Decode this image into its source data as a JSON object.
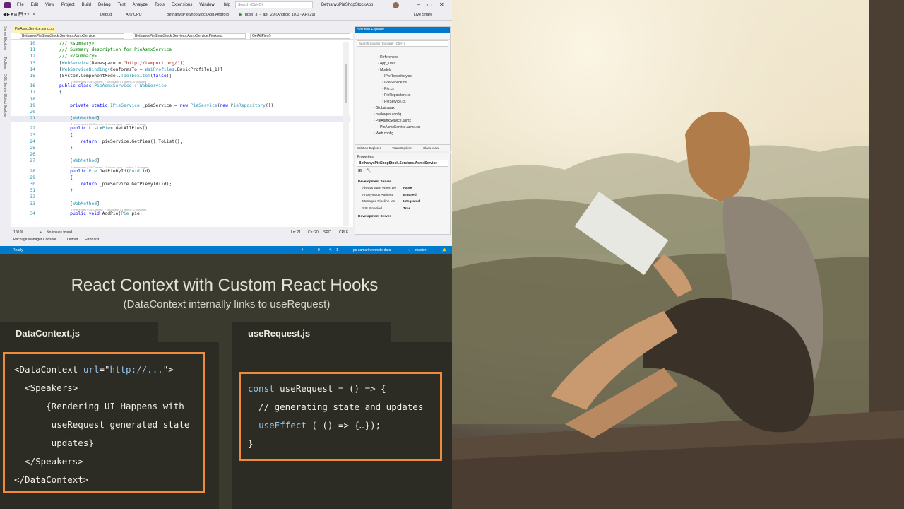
{
  "vs": {
    "menu": [
      "File",
      "Edit",
      "View",
      "Project",
      "Build",
      "Debug",
      "Test",
      "Analyze",
      "Tools",
      "Extensions",
      "Window",
      "Help"
    ],
    "search_placeholder": "Search (Ctrl+Q)",
    "app_title": "BethanysPieShopStockApp",
    "toolbar": {
      "config": "Debug",
      "platform": "Any CPU",
      "project": "BethanysPieShopStockApp.Android",
      "run_target": "pixel_3_-_api_29 (Android 10.0 - API 29)",
      "live_share": "Live Share"
    },
    "left_strip": [
      "Server Explorer",
      "Toolbox",
      "SQL Server Object Explorer"
    ],
    "doc_tab": "PieAsmxService.asmx.cs",
    "nav": {
      "project": "BethanysPieShopStock.Services.AsmxService",
      "class": "BethanysPieShopStock.Services.AsmxService.PieAsmx",
      "member": "GetAllPies()"
    },
    "code_lines": [
      {
        "n": "10",
        "parts": [
          {
            "t": "/// <summary>",
            "c": "cm"
          }
        ]
      },
      {
        "n": "11",
        "parts": [
          {
            "t": "/// Summary description for PieAsmxService",
            "c": "cm"
          }
        ]
      },
      {
        "n": "12",
        "parts": [
          {
            "t": "/// </summary>",
            "c": "cm"
          }
        ]
      },
      {
        "n": "13",
        "parts": [
          {
            "t": "[",
            "c": ""
          },
          {
            "t": "WebService",
            "c": "ty"
          },
          {
            "t": "(Namespace = ",
            "c": ""
          },
          {
            "t": "\"http://tempuri.org/\"",
            "c": "st"
          },
          {
            "t": ")]",
            "c": ""
          }
        ]
      },
      {
        "n": "14",
        "parts": [
          {
            "t": "[",
            "c": ""
          },
          {
            "t": "WebServiceBinding",
            "c": "ty"
          },
          {
            "t": "(ConformsTo = ",
            "c": ""
          },
          {
            "t": "WsiProfiles",
            "c": "ty"
          },
          {
            "t": ".BasicProfile1_1)]",
            "c": ""
          }
        ]
      },
      {
        "n": "15",
        "parts": [
          {
            "t": "[System.ComponentModel.",
            "c": ""
          },
          {
            "t": "ToolboxItem",
            "c": "ty"
          },
          {
            "t": "(",
            "c": ""
          },
          {
            "t": "false",
            "c": "kw"
          },
          {
            "t": ")]",
            "c": ""
          }
        ]
      },
      {
        "n": "16",
        "parts": [
          {
            "t": "public class ",
            "c": "kw"
          },
          {
            "t": "PieAsmxService",
            "c": "ty"
          },
          {
            "t": " : ",
            "c": ""
          },
          {
            "t": "WebService",
            "c": "ty"
          }
        ]
      },
      {
        "n": "17",
        "parts": [
          {
            "t": "{",
            "c": ""
          }
        ]
      },
      {
        "n": "18",
        "parts": [
          {
            "t": "",
            "c": ""
          }
        ]
      },
      {
        "n": "19",
        "parts": [
          {
            "t": "    private static ",
            "c": "kw"
          },
          {
            "t": "IPieService",
            "c": "ty"
          },
          {
            "t": " _pieService = ",
            "c": ""
          },
          {
            "t": "new ",
            "c": "kw"
          },
          {
            "t": "PieService",
            "c": "ty"
          },
          {
            "t": "(",
            "c": ""
          },
          {
            "t": "new ",
            "c": "kw"
          },
          {
            "t": "PieRepository",
            "c": "ty"
          },
          {
            "t": "());",
            "c": ""
          }
        ]
      },
      {
        "n": "20",
        "parts": [
          {
            "t": "",
            "c": ""
          }
        ]
      },
      {
        "n": "21",
        "parts": [
          {
            "t": "    [",
            "c": ""
          },
          {
            "t": "WebMethod",
            "c": "ty"
          },
          {
            "t": "]",
            "c": ""
          }
        ]
      },
      {
        "n": "22",
        "parts": [
          {
            "t": "    public ",
            "c": "kw"
          },
          {
            "t": "List",
            "c": "ty"
          },
          {
            "t": "<",
            "c": ""
          },
          {
            "t": "Pie",
            "c": "ty"
          },
          {
            "t": "> GetAllPies()",
            "c": ""
          }
        ]
      },
      {
        "n": "23",
        "parts": [
          {
            "t": "    {",
            "c": ""
          }
        ]
      },
      {
        "n": "24",
        "parts": [
          {
            "t": "        return ",
            "c": "kw"
          },
          {
            "t": "_pieService.GetPies().ToList();",
            "c": ""
          }
        ]
      },
      {
        "n": "25",
        "parts": [
          {
            "t": "    }",
            "c": ""
          }
        ]
      },
      {
        "n": "26",
        "parts": [
          {
            "t": "",
            "c": ""
          }
        ]
      },
      {
        "n": "27",
        "parts": [
          {
            "t": "    [",
            "c": ""
          },
          {
            "t": "WebMethod",
            "c": "ty"
          },
          {
            "t": "]",
            "c": ""
          }
        ]
      },
      {
        "n": "28",
        "parts": [
          {
            "t": "    public ",
            "c": "kw"
          },
          {
            "t": "Pie",
            "c": "ty"
          },
          {
            "t": " GetPieById(",
            "c": ""
          },
          {
            "t": "Guid",
            "c": "ty"
          },
          {
            "t": " id)",
            "c": ""
          }
        ]
      },
      {
        "n": "29",
        "parts": [
          {
            "t": "    {",
            "c": ""
          }
        ]
      },
      {
        "n": "30",
        "parts": [
          {
            "t": "        return ",
            "c": "kw"
          },
          {
            "t": "_pieService.GetPieById(id);",
            "c": ""
          }
        ]
      },
      {
        "n": "31",
        "parts": [
          {
            "t": "    }",
            "c": ""
          }
        ]
      },
      {
        "n": "32",
        "parts": [
          {
            "t": "",
            "c": ""
          }
        ]
      },
      {
        "n": "33",
        "parts": [
          {
            "t": "    [",
            "c": ""
          },
          {
            "t": "WebMethod",
            "c": "ty"
          },
          {
            "t": "]",
            "c": ""
          }
        ]
      },
      {
        "n": "34",
        "parts": [
          {
            "t": "    public void ",
            "c": "kw"
          },
          {
            "t": "AddPie(",
            "c": ""
          },
          {
            "t": "Pie",
            "c": "ty"
          },
          {
            "t": " pie)",
            "c": ""
          }
        ]
      }
    ],
    "code_lens": [
      "0 references | Gil Cleeren, 7 hours ago | 1 author, 3 changes",
      "0 references | Gil Cleeren, 15 hours ago | 1 author, 1 change",
      "0 references | Gil Cleeren, 15 hours ago | 1 author, 3 changes",
      "0 references | Gil Cleeren, 7 hours ago | 1 author, 2 changes"
    ],
    "status": {
      "zoom": "100 %",
      "issues": "No issues found",
      "ln": "Ln: 21",
      "ch": "Ch: 20",
      "spc": "SPC",
      "crlf": "CRLF"
    },
    "panel_tabs": [
      "Package Manager Console",
      "Output",
      "Error List"
    ],
    "statusbar": {
      "ready": "Ready",
      "up": "0",
      "pencil": "1",
      "repo": "ps-xamarin-remote-data",
      "branch": "master"
    },
    "solution_explorer": {
      "title": "Solution Explorer",
      "search": "Search Solution Explorer (Ctrl+;)",
      "items": [
        "References",
        "App_Data",
        "Models",
        "IPieRepository.cs",
        "IPieService.cs",
        "Pie.cs",
        "PieRepository.cs",
        "PieService.cs",
        "Global.asax",
        "packages.config",
        "PieAsmxService.asmx",
        "PieAsmxService.asmx.cs",
        "Web.config"
      ],
      "tabs": [
        "Solution Explorer",
        "Team Explorer",
        "Class View"
      ]
    },
    "properties": {
      "title": "Properties",
      "selected": "BethanysPieShopStock.Services.AsmxService",
      "section": "Development Server",
      "rows": [
        {
          "k": "Always Start When De",
          "v": "False"
        },
        {
          "k": "Anonymous Authent",
          "v": "Enabled"
        },
        {
          "k": "Managed Pipeline Mc",
          "v": "Integrated"
        },
        {
          "k": "SSL Enabled",
          "v": "True"
        }
      ],
      "footer": "Development Server"
    }
  },
  "slide": {
    "title": "React Context with Custom React Hooks",
    "subtitle": "(DataContext internally links to useRequest)",
    "left": {
      "tab": "DataContext.js",
      "lines": [
        [
          {
            "t": "<DataContext ",
            "c": ""
          },
          {
            "t": "url",
            "c": "blue"
          },
          {
            "t": "=\"",
            "c": ""
          },
          {
            "t": "http://...",
            "c": "blue"
          },
          {
            "t": "\">",
            "c": ""
          }
        ],
        [
          {
            "t": "  <Speakers>",
            "c": ""
          }
        ],
        [
          {
            "t": "      {Rendering UI Happens with",
            "c": ""
          }
        ],
        [
          {
            "t": "       useRequest generated state",
            "c": ""
          }
        ],
        [
          {
            "t": "       updates}",
            "c": ""
          }
        ],
        [
          {
            "t": "  </Speakers>",
            "c": ""
          }
        ],
        [
          {
            "t": "</DataContext>",
            "c": ""
          }
        ]
      ]
    },
    "right": {
      "tab": "useRequest.js",
      "lines": [
        [
          {
            "t": "const ",
            "c": "blue"
          },
          {
            "t": "useRequest = () => {",
            "c": ""
          }
        ],
        [
          {
            "t": "  // generating state and updates",
            "c": ""
          }
        ],
        [
          {
            "t": "  ",
            "c": ""
          },
          {
            "t": "useEffect",
            "c": "blue"
          },
          {
            "t": " ( () => {…});",
            "c": ""
          }
        ],
        [
          {
            "t": "}",
            "c": ""
          }
        ]
      ]
    }
  },
  "photo": {
    "description_icon": "woman-reading-tablet-photo"
  },
  "colors": {
    "accent_orange": "#f08a3c",
    "vs_blue": "#007acc",
    "slide_bg": "#3b3a2f"
  }
}
